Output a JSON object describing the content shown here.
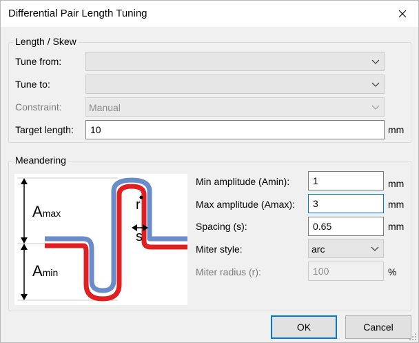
{
  "window": {
    "title": "Differential Pair Length Tuning"
  },
  "length_skew": {
    "group_title": "Length / Skew",
    "tune_from_label": "Tune from:",
    "tune_from_value": "",
    "tune_to_label": "Tune to:",
    "tune_to_value": "",
    "constraint_label": "Constraint:",
    "constraint_value": "Manual",
    "target_length_label": "Target length:",
    "target_length_value": "10",
    "target_length_unit": "mm"
  },
  "meandering": {
    "group_title": "Meandering",
    "diagram": {
      "amax_main": "A",
      "amax_sub": "max",
      "amin_main": "A",
      "amin_sub": "min",
      "r_label": "r",
      "s_label": "s"
    },
    "min_amplitude_label": "Min amplitude (Amin):",
    "min_amplitude_value": "1",
    "min_amplitude_unit": "mm",
    "max_amplitude_label": "Max amplitude (Amax):",
    "max_amplitude_value": "3",
    "max_amplitude_unit": "mm",
    "spacing_label": "Spacing (s):",
    "spacing_value": "0.65",
    "spacing_unit": "mm",
    "miter_style_label": "Miter style:",
    "miter_style_value": "arc",
    "miter_radius_label": "Miter radius (r):",
    "miter_radius_value": "100",
    "miter_radius_unit": "%"
  },
  "buttons": {
    "ok": "OK",
    "cancel": "Cancel"
  },
  "colors": {
    "trace_blue": "#6a8cc8",
    "trace_red": "#e02020",
    "accent": "#0078d7"
  }
}
